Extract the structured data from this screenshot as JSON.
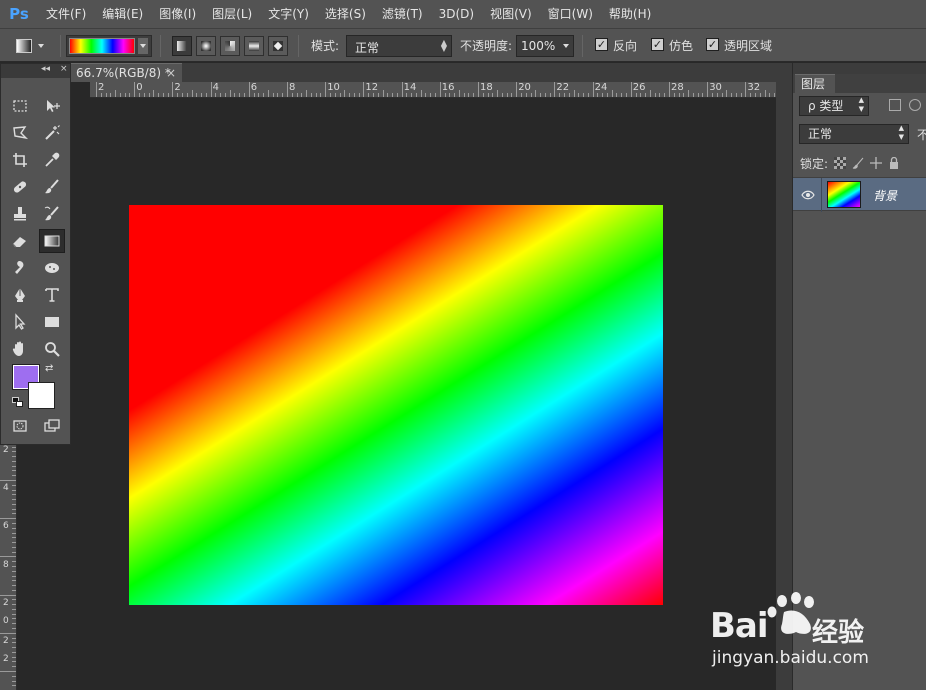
{
  "app": {
    "logo": "Ps"
  },
  "menu": [
    "文件(F)",
    "编辑(E)",
    "图像(I)",
    "图层(L)",
    "文字(Y)",
    "选择(S)",
    "滤镜(T)",
    "3D(D)",
    "视图(V)",
    "窗口(W)",
    "帮助(H)"
  ],
  "options": {
    "mode_label": "模式:",
    "mode_value": "正常",
    "opacity_label": "不透明度:",
    "opacity_value": "100%",
    "reverse_label": "反向",
    "dither_label": "仿色",
    "transparency_label": "透明区域",
    "reverse_checked": true,
    "dither_checked": true,
    "transparency_checked": true,
    "gradient_colors": [
      "#ff0000",
      "#ffff00",
      "#00ff00",
      "#00ffff",
      "#0000ff",
      "#ff00ff"
    ]
  },
  "document": {
    "tab_title": "66.7%(RGB/8) *",
    "close": "×"
  },
  "ruler": {
    "h_labels": [
      "2",
      "0",
      "2",
      "4",
      "6",
      "8",
      "10",
      "12",
      "14",
      "16",
      "18",
      "20",
      "22",
      "24",
      "26",
      "28",
      "30",
      "32"
    ],
    "v_labels": [
      "2",
      "4",
      "6",
      "8",
      "2 0",
      "2 2"
    ]
  },
  "toolbox": {
    "collapse": "◂◂",
    "close": "×",
    "foreground_color": "#9e6ef0",
    "background_color": "#ffffff"
  },
  "layers_panel": {
    "tab_label": "图层",
    "filter_label": "ρ 类型",
    "blend_mode": "正常",
    "opacity_abbrev": "不",
    "lock_label": "锁定:",
    "layers": [
      {
        "name": "背景",
        "visible": true,
        "selected": true
      }
    ]
  },
  "watermark": {
    "brand": "Bai",
    "brand_suffix": "经验",
    "url": "jingyan.baidu.com"
  }
}
